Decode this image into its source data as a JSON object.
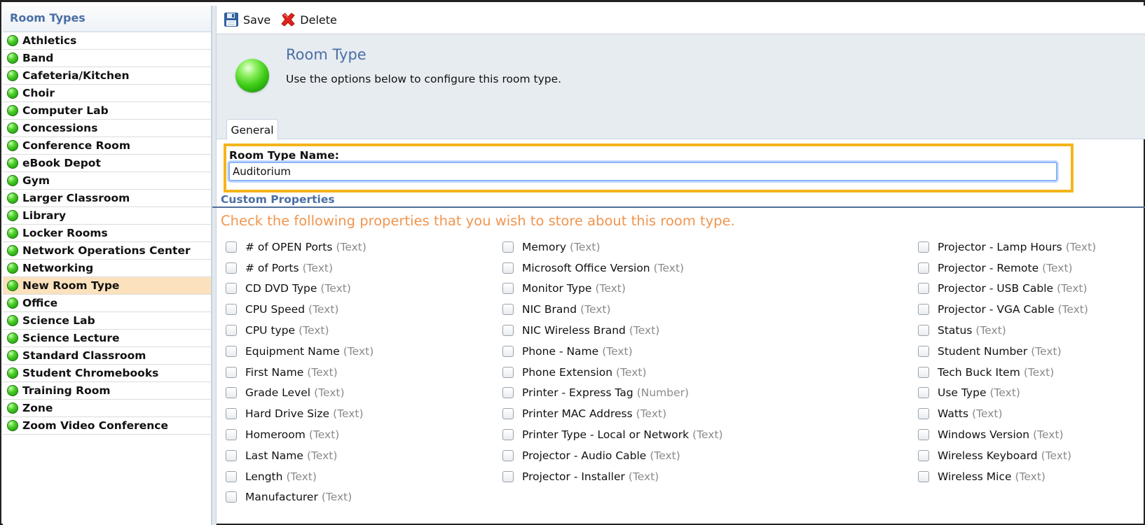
{
  "sidebar": {
    "header": "Room Types",
    "items": [
      {
        "label": "Athletics",
        "selected": false
      },
      {
        "label": "Band",
        "selected": false
      },
      {
        "label": "Cafeteria/Kitchen",
        "selected": false
      },
      {
        "label": "Choir",
        "selected": false
      },
      {
        "label": "Computer Lab",
        "selected": false
      },
      {
        "label": "Concessions",
        "selected": false
      },
      {
        "label": "Conference Room",
        "selected": false
      },
      {
        "label": "eBook Depot",
        "selected": false
      },
      {
        "label": "Gym",
        "selected": false
      },
      {
        "label": "Larger Classroom",
        "selected": false
      },
      {
        "label": "Library",
        "selected": false
      },
      {
        "label": "Locker Rooms",
        "selected": false
      },
      {
        "label": "Network Operations Center",
        "selected": false
      },
      {
        "label": "Networking",
        "selected": false
      },
      {
        "label": "New Room Type",
        "selected": true
      },
      {
        "label": "Office",
        "selected": false
      },
      {
        "label": "Science Lab",
        "selected": false
      },
      {
        "label": "Science Lecture",
        "selected": false
      },
      {
        "label": "Standard Classroom",
        "selected": false
      },
      {
        "label": "Student Chromebooks",
        "selected": false
      },
      {
        "label": "Training Room",
        "selected": false
      },
      {
        "label": "Zone",
        "selected": false
      },
      {
        "label": "Zoom Video Conference",
        "selected": false
      }
    ]
  },
  "toolbar": {
    "save_label": "Save",
    "delete_label": "Delete"
  },
  "header": {
    "title": "Room Type",
    "subtitle": "Use the options below to configure this room type."
  },
  "tabs": [
    {
      "label": "General",
      "active": true
    }
  ],
  "form": {
    "name_label": "Room Type Name:",
    "name_value": "Auditorium"
  },
  "custom_properties": {
    "title": "Custom Properties",
    "instruction": "Check the following properties that you wish to store about this room type.",
    "columns": [
      [
        {
          "name": "# of OPEN Ports",
          "type": "(Text)"
        },
        {
          "name": "# of Ports",
          "type": "(Text)"
        },
        {
          "name": "CD DVD Type",
          "type": "(Text)"
        },
        {
          "name": "CPU Speed",
          "type": "(Text)"
        },
        {
          "name": "CPU type",
          "type": "(Text)"
        },
        {
          "name": "Equipment Name",
          "type": "(Text)"
        },
        {
          "name": "First Name",
          "type": "(Text)"
        },
        {
          "name": "Grade Level",
          "type": "(Text)"
        },
        {
          "name": "Hard Drive Size",
          "type": "(Text)"
        },
        {
          "name": "Homeroom",
          "type": "(Text)"
        },
        {
          "name": "Last Name",
          "type": "(Text)"
        },
        {
          "name": "Length",
          "type": "(Text)"
        },
        {
          "name": "Manufacturer",
          "type": "(Text)"
        }
      ],
      [
        {
          "name": "Memory",
          "type": "(Text)"
        },
        {
          "name": "Microsoft Office Version",
          "type": "(Text)"
        },
        {
          "name": "Monitor Type",
          "type": "(Text)"
        },
        {
          "name": "NIC Brand",
          "type": "(Text)"
        },
        {
          "name": "NIC Wireless Brand",
          "type": "(Text)"
        },
        {
          "name": "Phone - Name",
          "type": "(Text)"
        },
        {
          "name": "Phone Extension",
          "type": "(Text)"
        },
        {
          "name": "Printer - Express Tag",
          "type": "(Number)"
        },
        {
          "name": "Printer MAC Address",
          "type": "(Text)"
        },
        {
          "name": "Printer Type - Local or Network",
          "type": "(Text)"
        },
        {
          "name": "Projector - Audio Cable",
          "type": "(Text)"
        },
        {
          "name": "Projector - Installer",
          "type": "(Text)"
        }
      ],
      [
        {
          "name": "Projector - Lamp Hours",
          "type": "(Text)"
        },
        {
          "name": "Projector - Remote",
          "type": "(Text)"
        },
        {
          "name": "Projector - USB Cable",
          "type": "(Text)"
        },
        {
          "name": "Projector - VGA Cable",
          "type": "(Text)"
        },
        {
          "name": "Status",
          "type": "(Text)"
        },
        {
          "name": "Student Number",
          "type": "(Text)"
        },
        {
          "name": "Tech Buck Item",
          "type": "(Text)"
        },
        {
          "name": "Use Type",
          "type": "(Text)"
        },
        {
          "name": "Watts",
          "type": "(Text)"
        },
        {
          "name": "Windows Version",
          "type": "(Text)"
        },
        {
          "name": "Wireless Keyboard",
          "type": "(Text)"
        },
        {
          "name": "Wireless Mice",
          "type": "(Text)"
        }
      ]
    ]
  },
  "colors": {
    "accent_blue": "#4a6fa5",
    "instruction_orange": "#f0954f",
    "highlight_yellow": "#f4b41a",
    "selected_bg": "#fbe2bd",
    "status_green": "#3fcc17"
  },
  "icons": {
    "status": "green-dot-icon",
    "save": "floppy-disk-icon",
    "delete": "red-x-icon"
  }
}
